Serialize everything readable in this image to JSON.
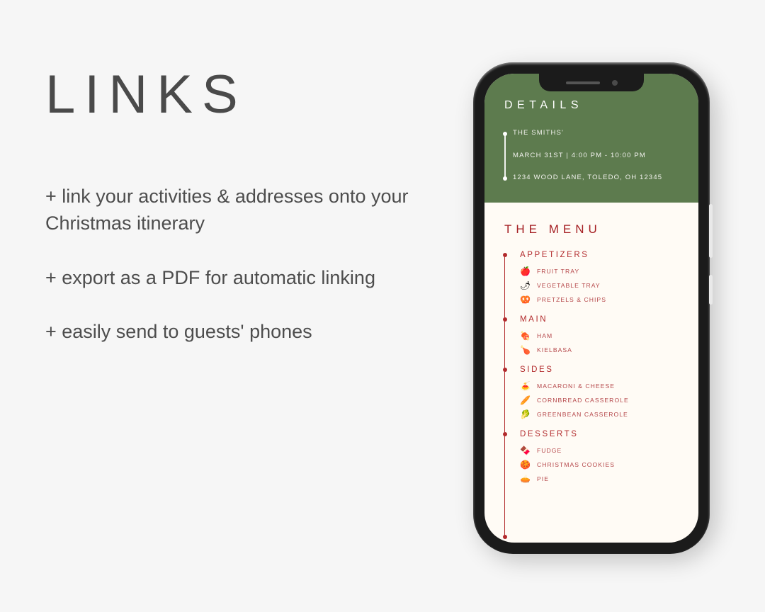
{
  "headline": "LINKS",
  "bullets": [
    "+  link your activities & addresses onto your Christmas itinerary",
    "+  export as a PDF for automatic linking",
    "+ easily send to guests' phones"
  ],
  "colors": {
    "page_background": "#f6f6f6",
    "green": "#5d7b4e",
    "cream": "#fffbf5",
    "red": "#a51f23",
    "item_red": "#b5474a",
    "text_gray": "#4d4d4d"
  },
  "phone": {
    "details": {
      "title": "DETAILS",
      "lines": [
        "THE SMITHS'",
        "MARCH 31ST | 4:00 PM - 10:00 PM",
        "1234 WOOD LANE, TOLEDO, OH 12345"
      ]
    },
    "menu": {
      "title": "THE MENU",
      "sections": [
        {
          "heading": "APPETIZERS",
          "items": [
            {
              "icon": "🍎",
              "icon_name": "apple-icon",
              "label": "FRUIT TRAY"
            },
            {
              "icon": "🌶",
              "icon_name": "pepper-icon",
              "label": "VEGETABLE TRAY"
            },
            {
              "icon": "🥨",
              "icon_name": "pretzel-icon",
              "label": "PRETZELS & CHIPS"
            }
          ]
        },
        {
          "heading": "MAIN",
          "items": [
            {
              "icon": "🍖",
              "icon_name": "meat-icon",
              "label": "HAM"
            },
            {
              "icon": "🍗",
              "icon_name": "poultry-icon",
              "label": "KIELBASA"
            }
          ]
        },
        {
          "heading": "SIDES",
          "items": [
            {
              "icon": "🍝",
              "icon_name": "pasta-icon",
              "label": "MACARONI & CHEESE"
            },
            {
              "icon": "🥖",
              "icon_name": "bread-icon",
              "label": "CORNBREAD CASSEROLE"
            },
            {
              "icon": "🥬",
              "icon_name": "greens-icon",
              "label": "GREENBEAN CASSEROLE"
            }
          ]
        },
        {
          "heading": "DESSERTS",
          "items": [
            {
              "icon": "🍫",
              "icon_name": "chocolate-icon",
              "label": "FUDGE"
            },
            {
              "icon": "🍪",
              "icon_name": "cookie-icon",
              "label": "CHRISTMAS COOKIES"
            },
            {
              "icon": "🥧",
              "icon_name": "pie-icon",
              "label": "PIE"
            }
          ]
        }
      ]
    }
  }
}
